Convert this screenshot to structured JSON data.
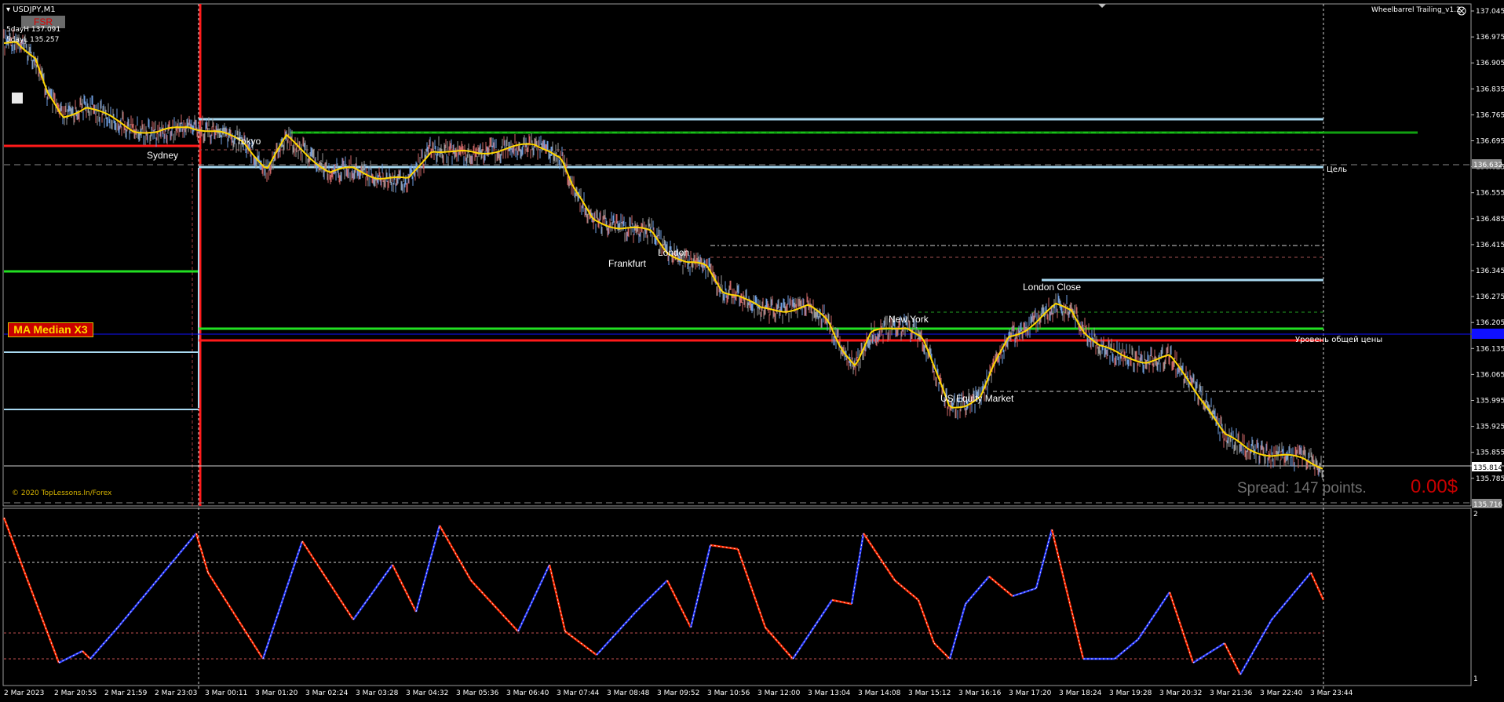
{
  "symbol": "USDJPY,M1",
  "fsr_button": "FSR",
  "sday_high": "5dayH 137.091",
  "sday_low": "5dayL 135.257",
  "indicator_name": "Wheelbarrel Trailing_v1.2",
  "ma_label": "MA Median X3",
  "copyright": "© 2020 TopLessons.In/Forex",
  "spread_text": "Spread: 147 points.",
  "pnl_text": "0.00$",
  "sessions": [
    "Sydney",
    "Tokyo",
    "Frankfurt",
    "London",
    "London Close",
    "New York",
    "US Equity Market"
  ],
  "level_labels": {
    "target": "Цель",
    "common_price": "Уровень общей цены"
  },
  "price_axis": [
    "137.045",
    "136.975",
    "136.905",
    "136.835",
    "136.765",
    "136.695",
    "136.625",
    "136.555",
    "136.485",
    "136.415",
    "136.345",
    "136.275",
    "136.205",
    "136.135",
    "136.065",
    "135.995",
    "135.925",
    "135.855",
    "135.785"
  ],
  "price_tags": {
    "upper": "136.632",
    "current": "135.814",
    "lower": "135.716",
    "blue": "136.177"
  },
  "oscillator_axis": [
    "2",
    "1"
  ],
  "time_axis": [
    "2 Mar 2023",
    "2 Mar 20:55",
    "2 Mar 21:59",
    "2 Mar 23:03",
    "3 Mar 00:11",
    "3 Mar 01:20",
    "3 Mar 02:24",
    "3 Mar 03:28",
    "3 Mar 04:32",
    "3 Mar 05:36",
    "3 Mar 06:40",
    "3 Mar 07:44",
    "3 Mar 08:48",
    "3 Mar 09:52",
    "3 Mar 10:56",
    "3 Mar 12:00",
    "3 Mar 13:04",
    "3 Mar 14:08",
    "3 Mar 15:12",
    "3 Mar 16:16",
    "3 Mar 17:20",
    "3 Mar 18:24",
    "3 Mar 19:28",
    "3 Mar 20:32",
    "3 Mar 21:36",
    "3 Mar 22:40",
    "3 Mar 23:44"
  ],
  "colors": {
    "bg": "#000000",
    "ma": "#ffd700",
    "red": "#ff1a1a",
    "green": "#22e022",
    "lightblue": "#a8d8f0",
    "blue": "#1010ff",
    "osc_red": "#ff2a00",
    "osc_blue": "#2a3cff"
  }
}
